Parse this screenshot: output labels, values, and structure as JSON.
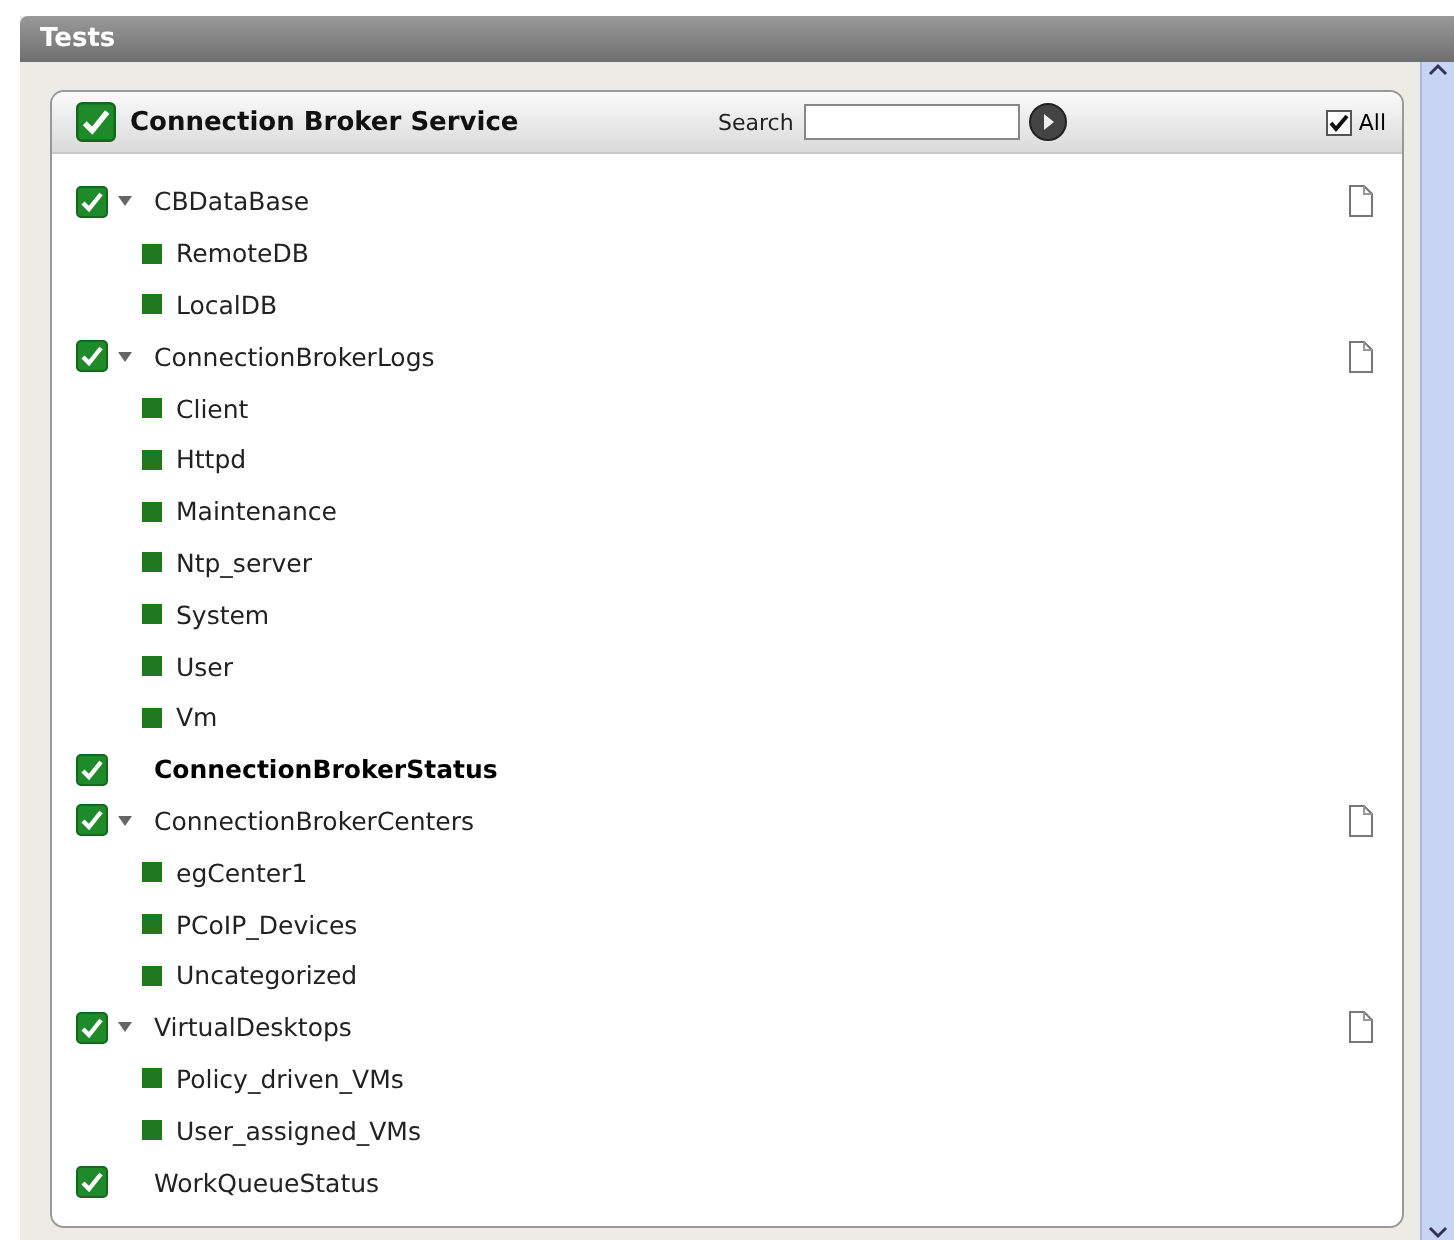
{
  "window": {
    "title": "Tests"
  },
  "panel": {
    "title": "Connection Broker Service",
    "checked": true,
    "search": {
      "label": "Search"
    },
    "all": {
      "label": "All",
      "checked": true
    }
  },
  "tests": [
    {
      "label": "CBDataBase",
      "checked": true,
      "selected": false,
      "expanded": true,
      "children": [
        {
          "label": "RemoteDB"
        },
        {
          "label": "LocalDB"
        }
      ]
    },
    {
      "label": "ConnectionBrokerLogs",
      "checked": true,
      "selected": false,
      "expanded": true,
      "children": [
        {
          "label": "Client"
        },
        {
          "label": "Httpd"
        },
        {
          "label": "Maintenance"
        },
        {
          "label": "Ntp_server"
        },
        {
          "label": "System"
        },
        {
          "label": "User"
        },
        {
          "label": "Vm"
        }
      ]
    },
    {
      "label": "ConnectionBrokerStatus",
      "checked": true,
      "selected": true
    },
    {
      "label": "ConnectionBrokerCenters",
      "checked": true,
      "selected": false,
      "expanded": true,
      "children": [
        {
          "label": "egCenter1"
        },
        {
          "label": "PCoIP_Devices"
        },
        {
          "label": "Uncategorized"
        }
      ]
    },
    {
      "label": "VirtualDesktops",
      "checked": true,
      "selected": false,
      "expanded": true,
      "children": [
        {
          "label": "Policy_driven_VMs"
        },
        {
          "label": "User_assigned_VMs"
        }
      ]
    },
    {
      "label": "WorkQueueStatus",
      "checked": true,
      "selected": false
    }
  ]
}
